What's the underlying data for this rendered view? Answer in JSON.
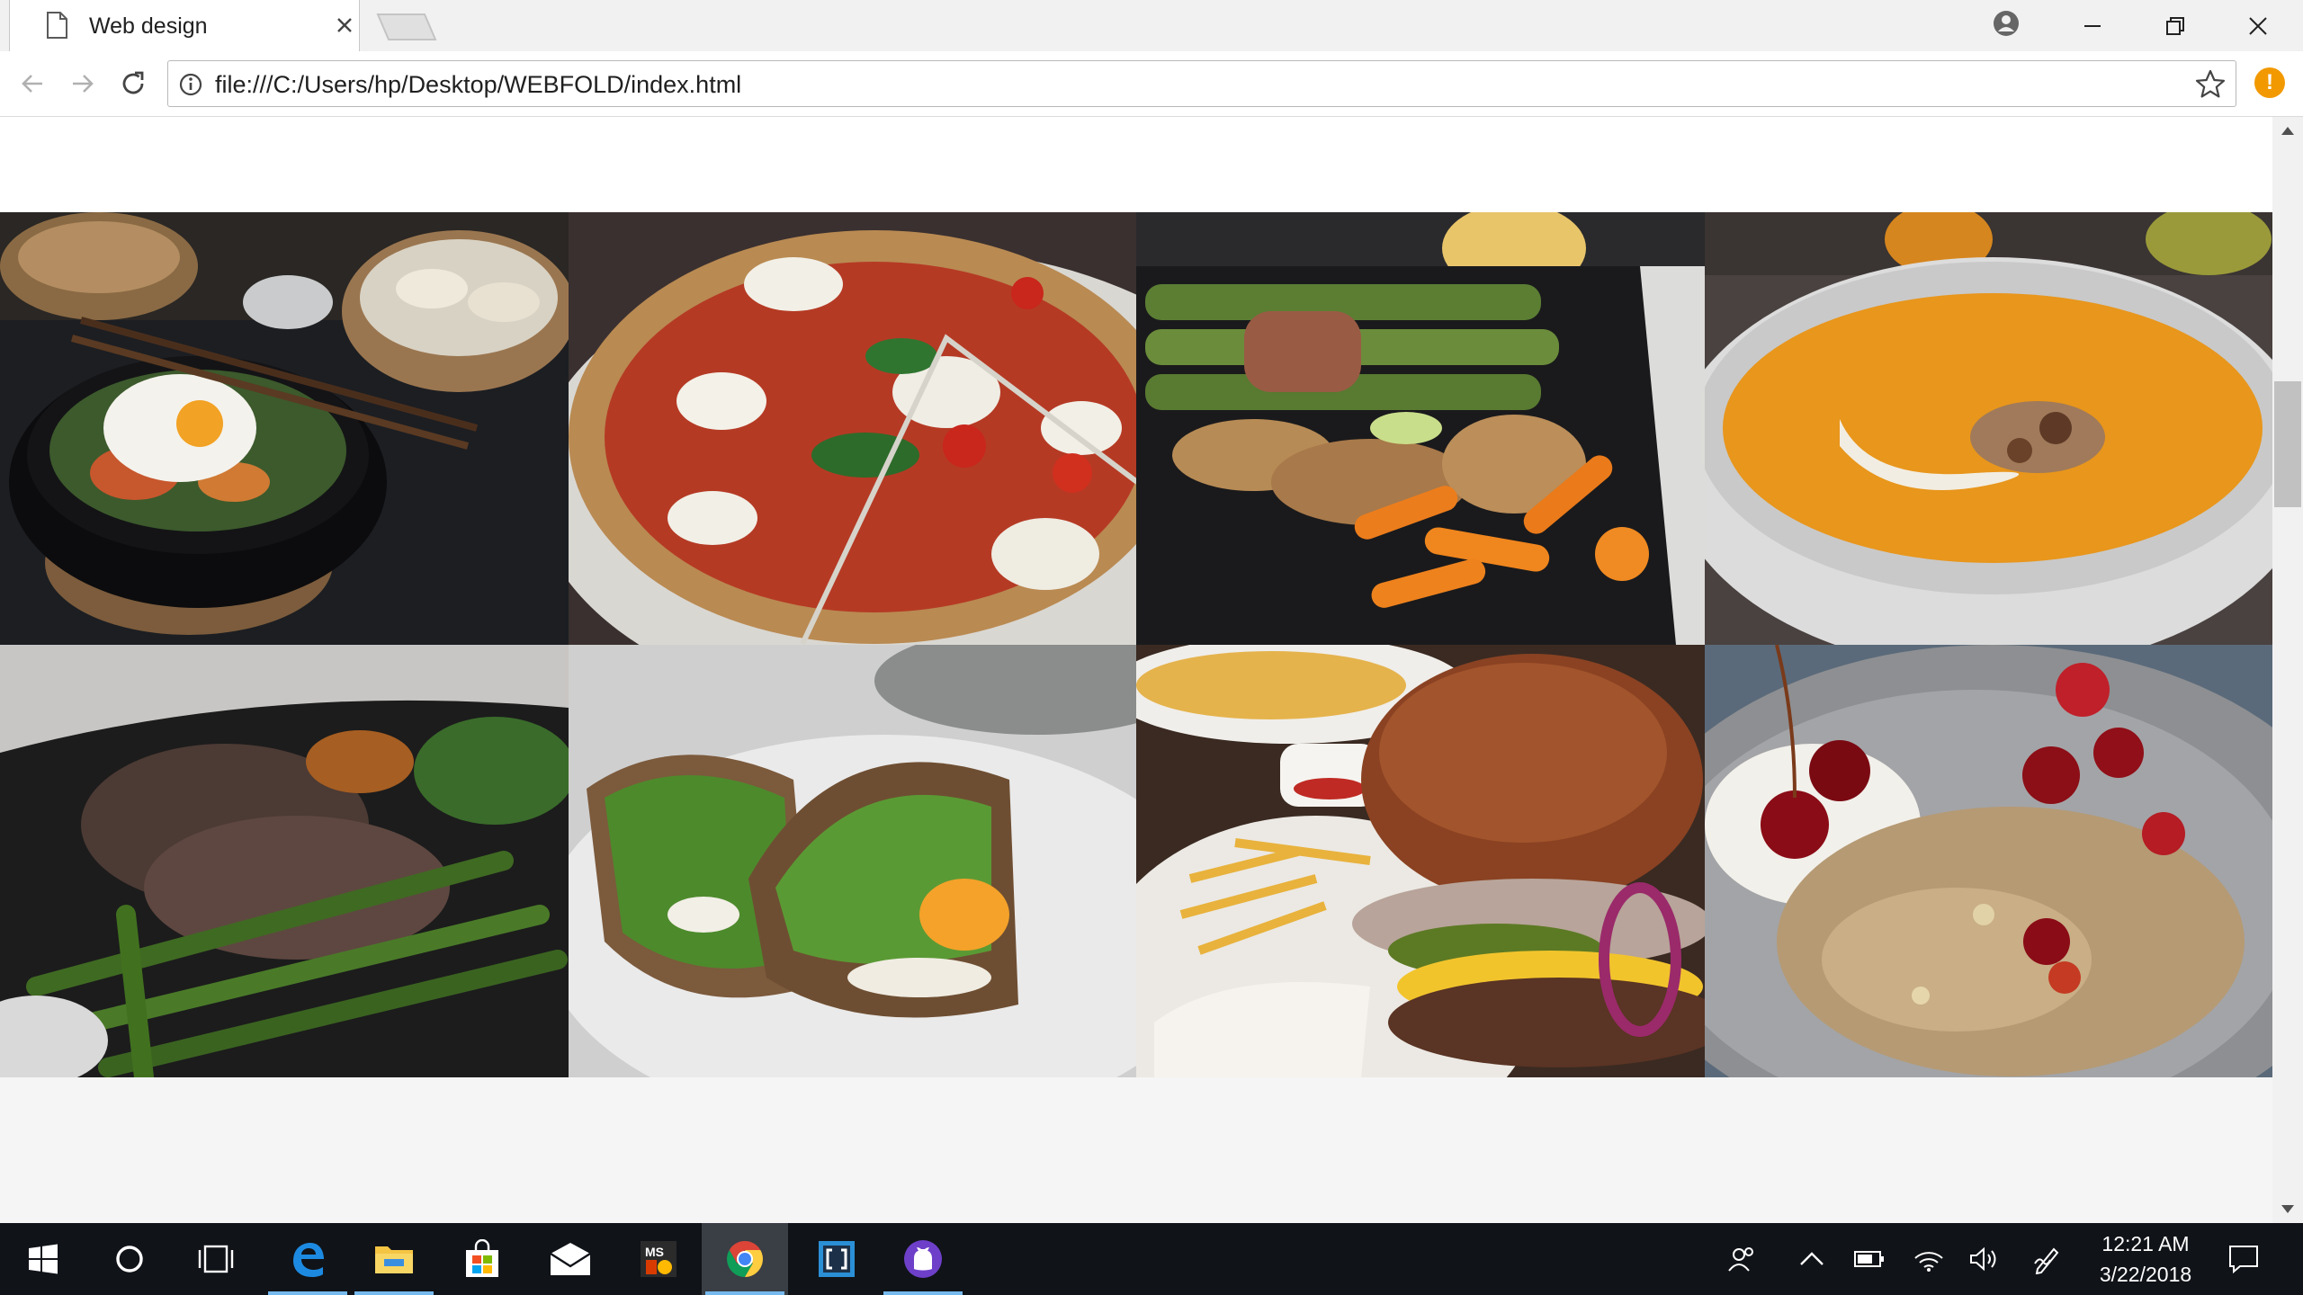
{
  "browser": {
    "tab": {
      "title": "Web design"
    },
    "address_bar": {
      "url": "file:///C:/Users/hp/Desktop/WEBFOLD/index.html"
    },
    "menu_badge": "!"
  },
  "gallery": {
    "items": [
      {
        "subject": "bibimbap-bowl-with-egg-and-dumplings"
      },
      {
        "subject": "margherita-pizza"
      },
      {
        "subject": "chicken-with-asparagus-and-carrots"
      },
      {
        "subject": "pumpkin-soup"
      },
      {
        "subject": "steak-with-green-beans"
      },
      {
        "subject": "salad-sandwich"
      },
      {
        "subject": "burger-with-fries"
      },
      {
        "subject": "granola-with-cherries-and-yogurt"
      }
    ]
  },
  "taskbar": {
    "apps": [
      "start",
      "search",
      "task-view",
      "edge",
      "file-explorer",
      "store",
      "mail",
      "ms-office",
      "chrome",
      "brackets",
      "github-desktop"
    ],
    "clock": {
      "time": "12:21 AM",
      "date": "3/22/2018"
    }
  },
  "colors": {
    "taskbar": "#101318",
    "taskbar_active": "#3a3e45",
    "taskbar_underline": "#76b9ed",
    "menu_badge": "#f29900",
    "page_background": "#f5f5f5"
  }
}
